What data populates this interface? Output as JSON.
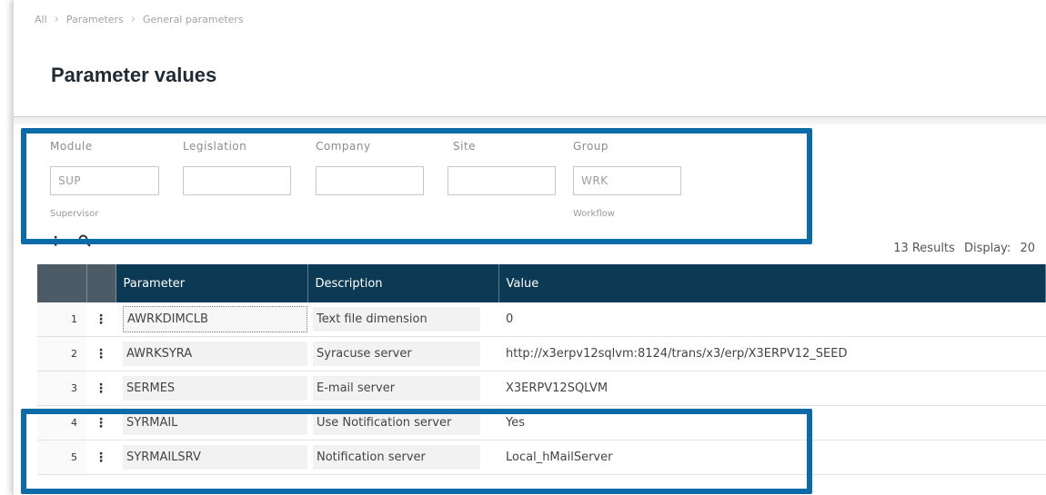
{
  "breadcrumb": [
    "All",
    "Parameters",
    "General parameters"
  ],
  "page_title": "Parameter values",
  "filters": [
    {
      "label": "Module",
      "value": "SUP",
      "sub": "Supervisor"
    },
    {
      "label": "Legislation",
      "value": "",
      "sub": ""
    },
    {
      "label": "Company",
      "value": "",
      "sub": ""
    },
    {
      "label": "Site",
      "value": "",
      "sub": ""
    },
    {
      "label": "Group",
      "value": "WRK",
      "sub": "Workflow"
    }
  ],
  "results": {
    "count_text": "13 Results",
    "display_label": "Display:",
    "display_value": "20"
  },
  "table": {
    "headers": [
      "Parameter",
      "Description",
      "Value"
    ],
    "rows": [
      {
        "n": "1",
        "param": "AWRKDIMCLB",
        "desc": "Text file dimension",
        "value": "0"
      },
      {
        "n": "2",
        "param": "AWRKSYRA",
        "desc": "Syracuse server",
        "value": "http://x3erpv12sqlvm:8124/trans/x3/erp/X3ERPV12_SEED"
      },
      {
        "n": "3",
        "param": "SERMES",
        "desc": "E-mail server",
        "value": "X3ERPV12SQLVM"
      },
      {
        "n": "4",
        "param": "SYRMAIL",
        "desc": "Use Notification server",
        "value": "Yes"
      },
      {
        "n": "5",
        "param": "SYRMAILSRV",
        "desc": "Notification server",
        "value": "Local_hMailServer"
      }
    ]
  },
  "colors": {
    "header_bg": "#0c3a55",
    "highlight": "#0a6ba8"
  }
}
